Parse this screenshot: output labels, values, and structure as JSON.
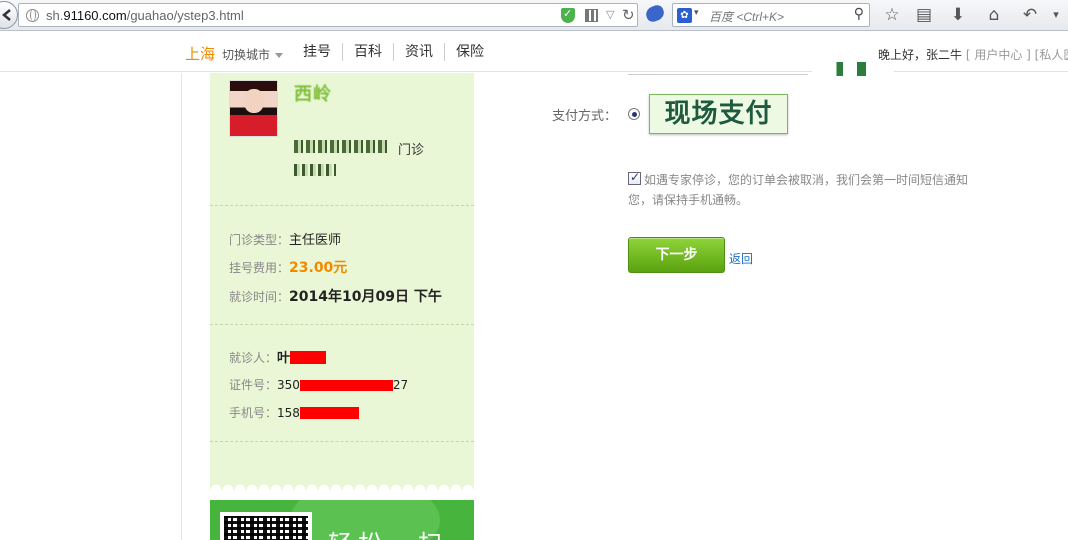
{
  "browser": {
    "url_prefix": "sh.",
    "url_domain": "91160.com",
    "url_path": "/guahao/ystep3.html",
    "search_placeholder": "百度 <Ctrl+K>"
  },
  "header": {
    "city": "上海",
    "switch_city": "切换城市",
    "nav": [
      "挂号",
      "百科",
      "资讯",
      "保险"
    ],
    "greeting": "晚上好，张二牛",
    "user_center": "[ 用户中心 ]",
    "private": "[私人医"
  },
  "doctor": {
    "name": "西岭",
    "dept_suffix": "门诊"
  },
  "booking": {
    "type_label": "门诊类型：",
    "type_value": "主任医师",
    "fee_label": "挂号费用：",
    "fee_value": "23.00元",
    "time_label": "就诊时间：",
    "time_value": "2014年10月09日 下午"
  },
  "patient": {
    "name_label": "就诊人：",
    "name_value": "叶",
    "id_label": "证件号：",
    "id_prefix": "350",
    "id_suffix": "27",
    "phone_label": "手机号：",
    "phone_prefix": "158"
  },
  "banner": {
    "text": "轻松一扫"
  },
  "payment": {
    "label": "支付方式：",
    "option": "现场支付"
  },
  "notice": "如遇专家停诊，您的订单会被取消，我们会第一时间短信通知您，请保持手机通畅。",
  "actions": {
    "next": "下一步",
    "back": "返回"
  },
  "colors": {
    "panel_bg": "#eaf7d6",
    "accent_orange": "#f08b00",
    "button_green": "#5aa20f",
    "link_blue": "#1b6fc2"
  }
}
